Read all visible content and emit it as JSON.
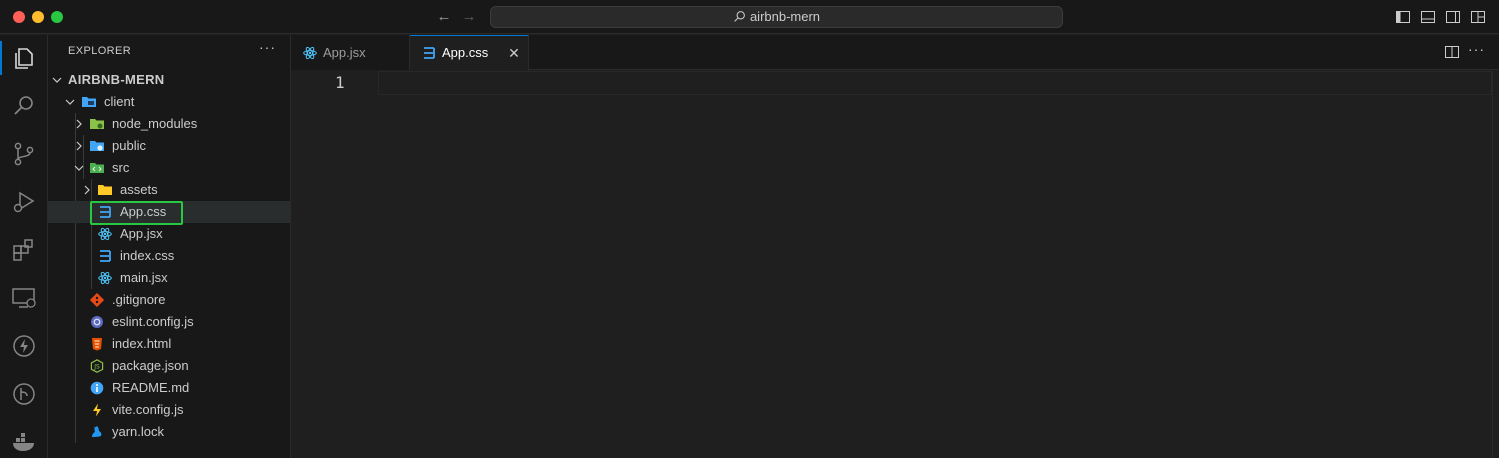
{
  "titlebar": {
    "search_text": "airbnb-mern"
  },
  "sidebar": {
    "header": "EXPLORER",
    "more": "···",
    "root": "AIRBNB-MERN",
    "tree": [
      {
        "label": "client",
        "type": "folder-open",
        "icon": "client-folder-icon"
      },
      {
        "label": "node_modules",
        "type": "folder",
        "icon": "node-folder-icon"
      },
      {
        "label": "public",
        "type": "folder",
        "icon": "public-folder-icon"
      },
      {
        "label": "src",
        "type": "folder-open",
        "icon": "src-folder-icon"
      },
      {
        "label": "assets",
        "type": "folder",
        "icon": "assets-folder-icon"
      },
      {
        "label": "App.css",
        "type": "file",
        "icon": "css-file-icon"
      },
      {
        "label": "App.jsx",
        "type": "file",
        "icon": "react-file-icon"
      },
      {
        "label": "index.css",
        "type": "file",
        "icon": "css-file-icon"
      },
      {
        "label": "main.jsx",
        "type": "file",
        "icon": "react-file-icon"
      },
      {
        "label": ".gitignore",
        "type": "file",
        "icon": "git-file-icon"
      },
      {
        "label": "eslint.config.js",
        "type": "file",
        "icon": "eslint-file-icon"
      },
      {
        "label": "index.html",
        "type": "file",
        "icon": "html-file-icon"
      },
      {
        "label": "package.json",
        "type": "file",
        "icon": "npm-file-icon"
      },
      {
        "label": "README.md",
        "type": "file",
        "icon": "info-file-icon"
      },
      {
        "label": "vite.config.js",
        "type": "file",
        "icon": "vite-file-icon"
      },
      {
        "label": "yarn.lock",
        "type": "file",
        "icon": "yarn-file-icon"
      }
    ]
  },
  "tabs": [
    {
      "label": "App.jsx",
      "icon": "react-file-icon"
    },
    {
      "label": "App.css",
      "icon": "css-file-icon",
      "active": true
    }
  ],
  "editor": {
    "line_number": "1"
  },
  "colors": {
    "accent": "#0078d4",
    "highlight": "#28c840",
    "css": "#42a5f5",
    "react": "#4fc3f7",
    "git": "#e64a19"
  }
}
